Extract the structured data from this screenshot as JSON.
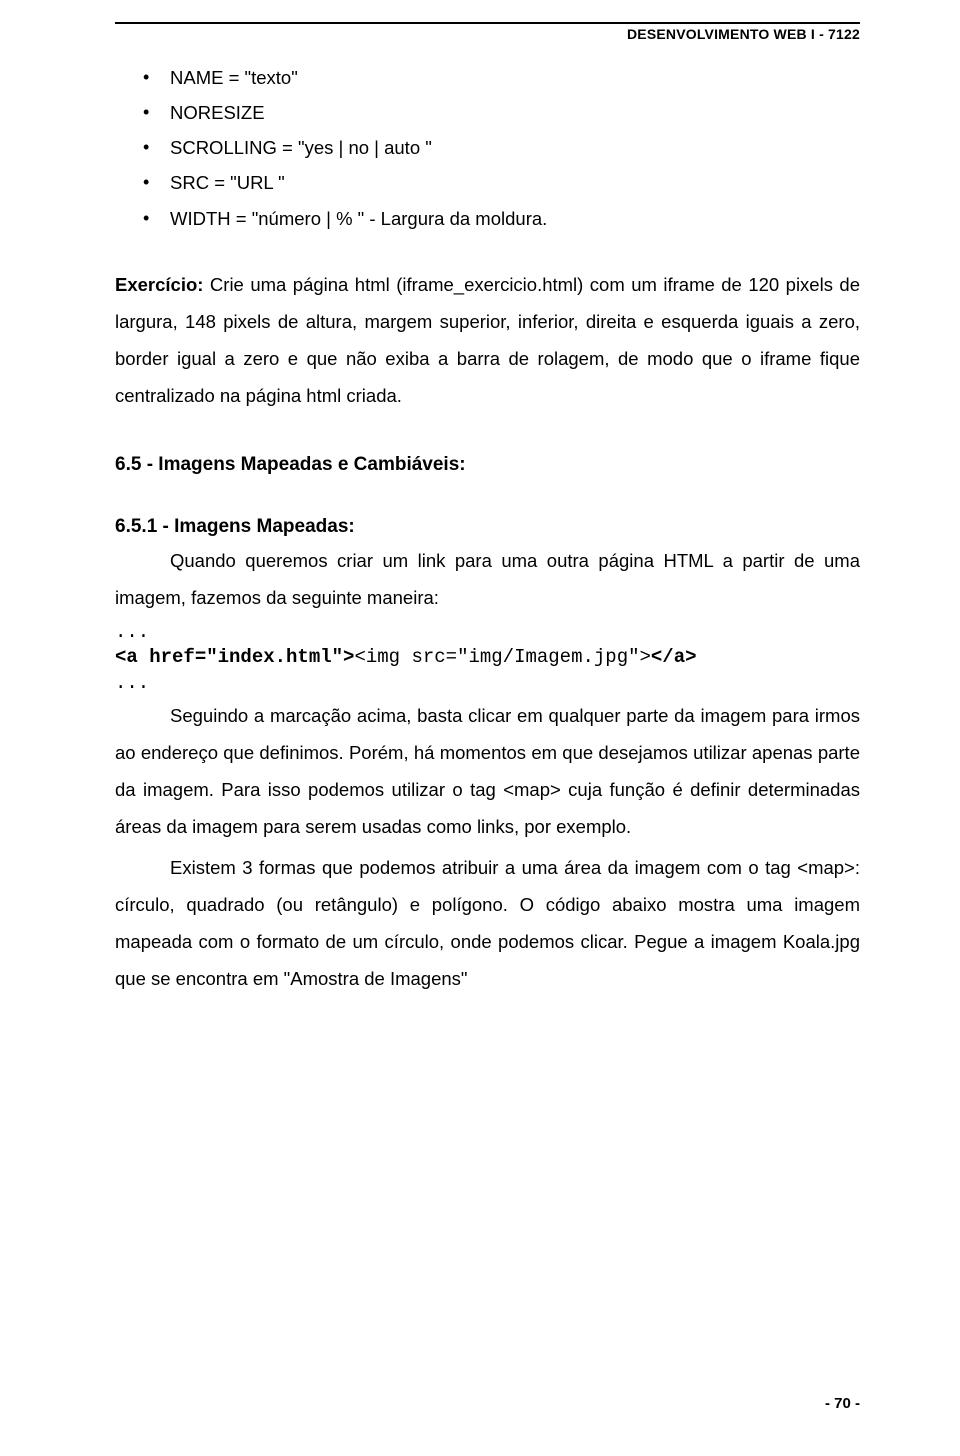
{
  "header": {
    "title": "DESENVOLVIMENTO WEB I - 7122"
  },
  "bullets": {
    "b1": "NAME = \"texto\"",
    "b2": "NORESIZE",
    "b3": "SCROLLING = \"yes | no | auto \"",
    "b4": "SRC = \"URL \"",
    "b5": "WIDTH = \"número | % \" - Largura da moldura."
  },
  "exercise": {
    "lead": "Exercício: ",
    "text": "Crie uma página html (iframe_exercicio.html) com um iframe de 120 pixels de largura, 148 pixels de altura, margem superior, inferior, direita e esquerda iguais a zero, border igual a zero e que não exiba a barra de rolagem, de modo que o iframe fique centralizado na página html criada."
  },
  "section": {
    "title": "6.5 - Imagens Mapeadas e Cambiáveis:"
  },
  "subsection": {
    "title": "6.5.1 - Imagens Mapeadas:",
    "p1": "Quando queremos criar um link para uma outra página HTML a partir de uma imagem, fazemos da seguinte maneira:"
  },
  "code": {
    "dots1": "...",
    "a_open": "<a href=\"index.html\">",
    "img": "<img src=\"img/Imagem.jpg\">",
    "a_close": "</a>",
    "dots2": "..."
  },
  "p2": "Seguindo a marcação acima, basta clicar em qualquer parte da imagem para irmos ao endereço que definimos. Porém, há momentos em que desejamos utilizar apenas parte da imagem. Para isso podemos utilizar o tag <map> cuja função é definir determinadas áreas da imagem para serem usadas como links, por exemplo.",
  "p3": "Existem 3 formas que podemos atribuir a uma área da imagem com o tag <map>: círculo, quadrado (ou retângulo) e polígono. O código abaixo mostra uma imagem mapeada com o formato de um círculo, onde podemos clicar. Pegue a imagem Koala.jpg que se encontra em \"Amostra de Imagens\"",
  "footer": {
    "page": "- 70 -"
  }
}
